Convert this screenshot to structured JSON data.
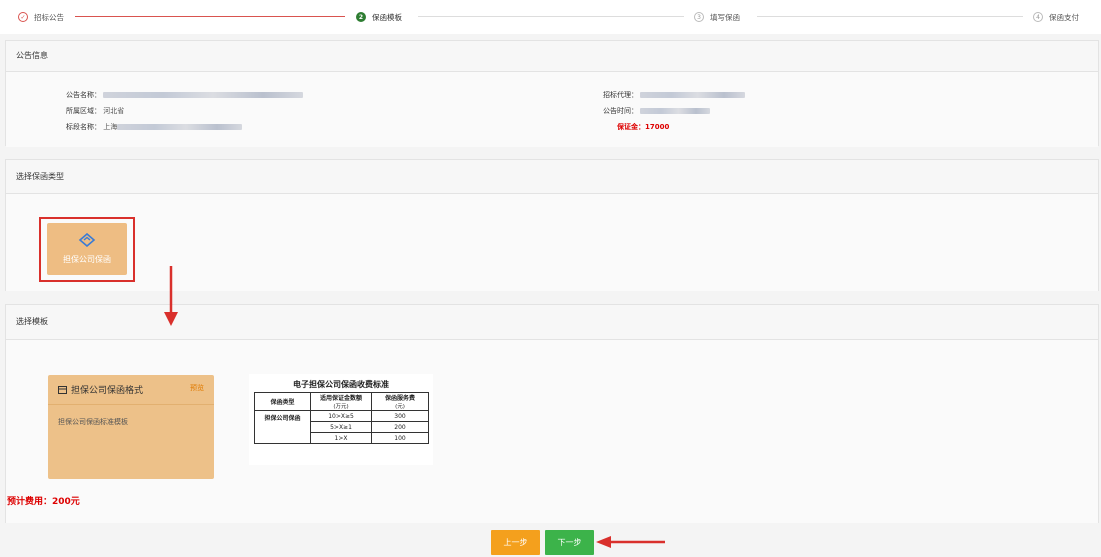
{
  "steps": [
    {
      "num": "✓",
      "label": "招标公告",
      "state": "done"
    },
    {
      "num": "2",
      "label": "保函模板",
      "state": "active"
    },
    {
      "num": "3",
      "label": "填写保函",
      "state": "pending"
    },
    {
      "num": "4",
      "label": "保函支付",
      "state": "pending"
    }
  ],
  "notice": {
    "header": "公告信息",
    "name_label": "公告名称：",
    "region_label": "所属区域：",
    "region_value": "河北省",
    "section_label": "标段名称：",
    "section_prefix": "上海",
    "agent_label": "招标代理：",
    "time_label": "公告时间：",
    "deposit_label": "保证金：",
    "deposit_value": "17000"
  },
  "guarantee_type": {
    "header": "选择保函类型",
    "option_label": "担保公司保函",
    "option_icon": "diamond-handshake-icon"
  },
  "template": {
    "header": "选择模板",
    "card_title": "担保公司保函格式",
    "card_icon": "document-icon",
    "preview_label": "预览",
    "card_desc": "担保公司保函标准模板"
  },
  "fee_table": {
    "title": "电子担保公司保函收费标准",
    "headers": [
      "保函类型",
      "适用保证金数额",
      "保函服务费"
    ],
    "units": [
      "",
      "(万元)",
      "(元)"
    ],
    "type_cell": "担保公司保函",
    "rows": [
      {
        "range": "10>X≥5",
        "fee": "300"
      },
      {
        "range": "5>X≥1",
        "fee": "200"
      },
      {
        "range": "1>X",
        "fee": "100"
      }
    ]
  },
  "estimate": {
    "label": "预计费用：",
    "value": "200元"
  },
  "buttons": {
    "prev": "上一步",
    "next": "下一步"
  },
  "colors": {
    "accent_red": "#d9302c",
    "card": "#eebd83",
    "next_green": "#3cb34a",
    "prev_orange": "#f4a01d"
  }
}
